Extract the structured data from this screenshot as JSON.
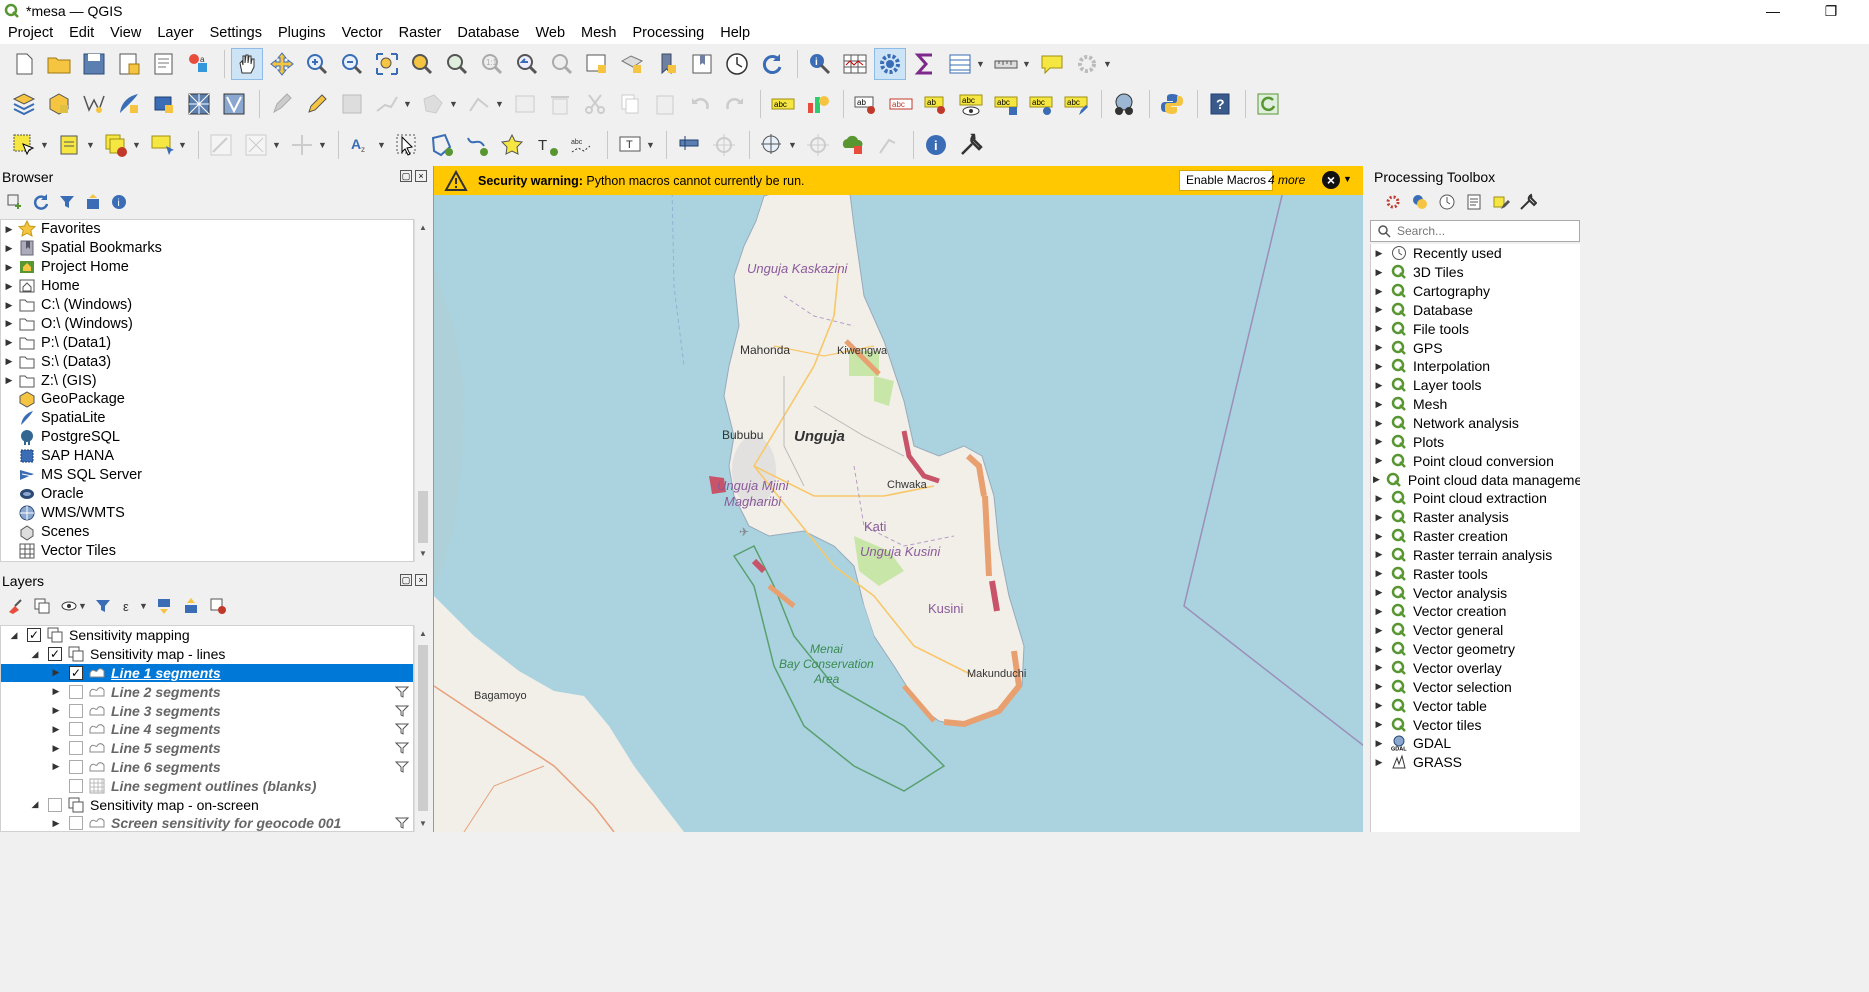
{
  "window": {
    "title": "*mesa — QGIS",
    "minimize": "—",
    "restore": "❐"
  },
  "menu": [
    "Project",
    "Edit",
    "View",
    "Layer",
    "Settings",
    "Plugins",
    "Vector",
    "Raster",
    "Database",
    "Web",
    "Mesh",
    "Processing",
    "Help"
  ],
  "browser": {
    "title": "Browser",
    "items": [
      {
        "label": "Favorites",
        "icon": "star-icon",
        "expand": true
      },
      {
        "label": "Spatial Bookmarks",
        "icon": "bookmark-icon",
        "expand": true
      },
      {
        "label": "Project Home",
        "icon": "project-home-icon",
        "expand": true
      },
      {
        "label": "Home",
        "icon": "home-folder-icon",
        "expand": true
      },
      {
        "label": "C:\\ (Windows)",
        "icon": "folder-icon",
        "expand": true
      },
      {
        "label": "O:\\ (Windows)",
        "icon": "folder-icon",
        "expand": true
      },
      {
        "label": "P:\\ (Data1)",
        "icon": "folder-icon",
        "expand": true
      },
      {
        "label": "S:\\ (Data3)",
        "icon": "folder-icon",
        "expand": true
      },
      {
        "label": "Z:\\ (GIS)",
        "icon": "folder-icon",
        "expand": true
      },
      {
        "label": "GeoPackage",
        "icon": "geopackage-icon",
        "expand": false
      },
      {
        "label": "SpatiaLite",
        "icon": "spatialite-icon",
        "expand": false
      },
      {
        "label": "PostgreSQL",
        "icon": "postgresql-icon",
        "expand": false
      },
      {
        "label": "SAP HANA",
        "icon": "sap-hana-icon",
        "expand": false
      },
      {
        "label": "MS SQL Server",
        "icon": "mssql-icon",
        "expand": false
      },
      {
        "label": "Oracle",
        "icon": "oracle-icon",
        "expand": false
      },
      {
        "label": "WMS/WMTS",
        "icon": "wms-icon",
        "expand": false
      },
      {
        "label": "Scenes",
        "icon": "scenes-icon",
        "expand": false
      },
      {
        "label": "Vector Tiles",
        "icon": "vector-tiles-icon",
        "expand": false
      }
    ]
  },
  "layers": {
    "title": "Layers",
    "rows": [
      {
        "label": "Sensitivity mapping",
        "level": 0,
        "checked": true,
        "arrow": "open",
        "kind": "group",
        "filter": false,
        "selected": false
      },
      {
        "label": "Sensitivity map - lines",
        "level": 1,
        "checked": true,
        "arrow": "open",
        "kind": "group",
        "filter": false,
        "selected": false
      },
      {
        "label": "Line 1 segments",
        "level": 2,
        "checked": true,
        "arrow": "closed",
        "kind": "line",
        "filter": false,
        "selected": true
      },
      {
        "label": "Line 2 segments",
        "level": 2,
        "checked": false,
        "arrow": "closed",
        "kind": "line",
        "filter": true,
        "selected": false
      },
      {
        "label": "Line 3 segments",
        "level": 2,
        "checked": false,
        "arrow": "closed",
        "kind": "line",
        "filter": true,
        "selected": false
      },
      {
        "label": "Line 4 segments",
        "level": 2,
        "checked": false,
        "arrow": "closed",
        "kind": "line",
        "filter": true,
        "selected": false
      },
      {
        "label": "Line 5 segments",
        "level": 2,
        "checked": false,
        "arrow": "closed",
        "kind": "line",
        "filter": true,
        "selected": false
      },
      {
        "label": "Line 6 segments",
        "level": 2,
        "checked": false,
        "arrow": "closed",
        "kind": "line",
        "filter": true,
        "selected": false
      },
      {
        "label": "Line segment outlines (blanks)",
        "level": 2,
        "checked": false,
        "arrow": "none",
        "kind": "grid",
        "filter": false,
        "selected": false
      },
      {
        "label": "Sensitivity map - on-screen",
        "level": 1,
        "checked": false,
        "arrow": "open",
        "kind": "group",
        "filter": false,
        "selected": false
      },
      {
        "label": "Screen sensitivity for geocode 001",
        "level": 2,
        "checked": false,
        "arrow": "closed",
        "kind": "line",
        "filter": true,
        "selected": false
      }
    ]
  },
  "warning": {
    "bold": "Security warning:",
    "text": " Python macros cannot currently be run.",
    "button": "Enable Macros",
    "more": "4 more"
  },
  "map_labels": {
    "kaskazini": "Unguja Kaskazini",
    "mahonda": "Mahonda",
    "kiwengwa": "Kiwengwa",
    "bububu": "Bububu",
    "unguja": "Unguja",
    "mjini": "Unguja Mjini",
    "magharibi": "Magharibi",
    "chwaka": "Chwaka",
    "kati": "Kati",
    "kusini_region": "Unguja Kusini",
    "kusini": "Kusini",
    "menai1": "Menai",
    "menai2": "Bay Conservation",
    "menai3": "Area",
    "bagamoyo": "Bagamoyo",
    "makunduchi": "Makunduchi"
  },
  "processing": {
    "title": "Processing Toolbox",
    "search_placeholder": "Search...",
    "items": [
      {
        "label": "Recently used",
        "icon": "clock-icon"
      },
      {
        "label": "3D Tiles",
        "icon": "qgis-icon"
      },
      {
        "label": "Cartography",
        "icon": "qgis-icon"
      },
      {
        "label": "Database",
        "icon": "qgis-icon"
      },
      {
        "label": "File tools",
        "icon": "qgis-icon"
      },
      {
        "label": "GPS",
        "icon": "qgis-icon"
      },
      {
        "label": "Interpolation",
        "icon": "qgis-icon"
      },
      {
        "label": "Layer tools",
        "icon": "qgis-icon"
      },
      {
        "label": "Mesh",
        "icon": "qgis-icon"
      },
      {
        "label": "Network analysis",
        "icon": "qgis-icon"
      },
      {
        "label": "Plots",
        "icon": "qgis-icon"
      },
      {
        "label": "Point cloud conversion",
        "icon": "qgis-icon"
      },
      {
        "label": "Point cloud data management",
        "icon": "qgis-icon"
      },
      {
        "label": "Point cloud extraction",
        "icon": "qgis-icon"
      },
      {
        "label": "Raster analysis",
        "icon": "qgis-icon"
      },
      {
        "label": "Raster creation",
        "icon": "qgis-icon"
      },
      {
        "label": "Raster terrain analysis",
        "icon": "qgis-icon"
      },
      {
        "label": "Raster tools",
        "icon": "qgis-icon"
      },
      {
        "label": "Vector analysis",
        "icon": "qgis-icon"
      },
      {
        "label": "Vector creation",
        "icon": "qgis-icon"
      },
      {
        "label": "Vector general",
        "icon": "qgis-icon"
      },
      {
        "label": "Vector geometry",
        "icon": "qgis-icon"
      },
      {
        "label": "Vector overlay",
        "icon": "qgis-icon"
      },
      {
        "label": "Vector selection",
        "icon": "qgis-icon"
      },
      {
        "label": "Vector table",
        "icon": "qgis-icon"
      },
      {
        "label": "Vector tiles",
        "icon": "qgis-icon"
      },
      {
        "label": "GDAL",
        "icon": "gdal-icon"
      },
      {
        "label": "GRASS",
        "icon": "grass-icon"
      }
    ]
  },
  "colors": {
    "selection": "#0078d7",
    "warning": "#ffc800",
    "sea": "#aad3df",
    "land": "#f2efe9",
    "qgis_green": "#589632"
  }
}
